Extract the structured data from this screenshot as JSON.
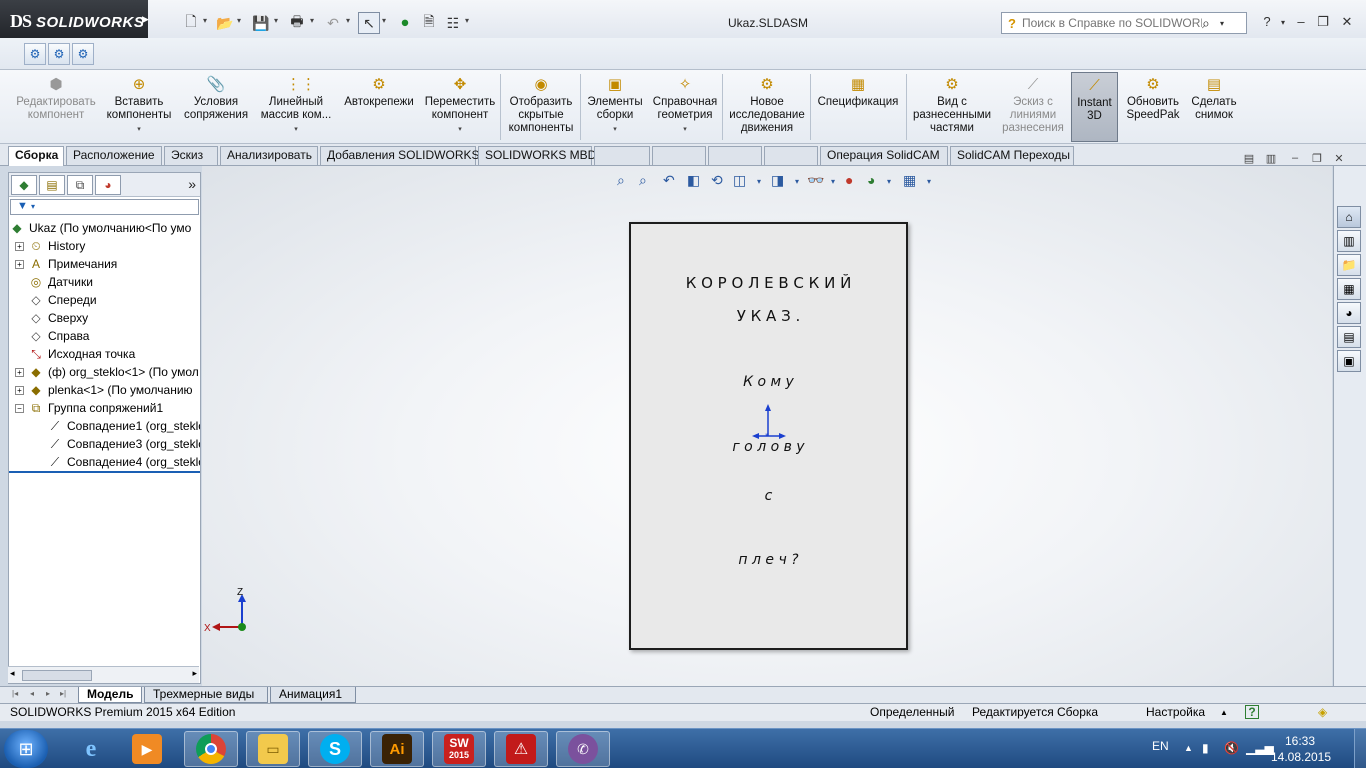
{
  "app": {
    "logo_mark": "DS",
    "logo_text": "SOLIDWORKS",
    "document_title": "Ukaz.SLDASM",
    "help_search_placeholder": "Поиск в Справке по SOLIDWORKS",
    "help_button": "?"
  },
  "command_manager": [
    {
      "label1": "Редактировать",
      "label2": "компонент",
      "label3": "",
      "icon": "edit-component-icon",
      "disabled": true
    },
    {
      "label1": "Вставить",
      "label2": "компоненты",
      "label3": "",
      "icon": "insert-components-icon",
      "disabled": false
    },
    {
      "label1": "Условия",
      "label2": "сопряжения",
      "label3": "",
      "icon": "mate-icon",
      "disabled": false
    },
    {
      "label1": "Линейный",
      "label2": "массив ком...",
      "label3": "",
      "icon": "linear-pattern-icon",
      "disabled": false
    },
    {
      "label1": "Автокрепежи",
      "label2": "",
      "label3": "",
      "icon": "smart-fasteners-icon",
      "disabled": false
    },
    {
      "label1": "Переместить",
      "label2": "компонент",
      "label3": "",
      "icon": "move-component-icon",
      "disabled": false
    },
    {
      "label1": "Отобразить",
      "label2": "скрытые",
      "label3": "компоненты",
      "icon": "show-hidden-icon",
      "disabled": false
    },
    {
      "label1": "Элементы",
      "label2": "сборки",
      "label3": "",
      "icon": "assembly-features-icon",
      "disabled": false
    },
    {
      "label1": "Справочная",
      "label2": "геометрия",
      "label3": "",
      "icon": "reference-geometry-icon",
      "disabled": false
    },
    {
      "label1": "Новое",
      "label2": "исследование",
      "label3": "движения",
      "icon": "motion-study-icon",
      "disabled": false
    },
    {
      "label1": "Спецификация",
      "label2": "",
      "label3": "",
      "icon": "bom-icon",
      "disabled": false
    },
    {
      "label1": "Вид с",
      "label2": "разнесенными",
      "label3": "частями",
      "icon": "exploded-view-icon",
      "disabled": false
    },
    {
      "label1": "Эскиз с",
      "label2": "линиями",
      "label3": "разнесения",
      "icon": "explode-line-sketch-icon",
      "disabled": true
    },
    {
      "label1": "Instant",
      "label2": "3D",
      "label3": "",
      "icon": "instant3d-icon",
      "disabled": false
    },
    {
      "label1": "Обновить",
      "label2": "SpeedPak",
      "label3": "",
      "icon": "speedpak-icon",
      "disabled": false
    },
    {
      "label1": "Сделать",
      "label2": "снимок",
      "label3": "",
      "icon": "snapshot-icon",
      "disabled": false
    }
  ],
  "tabs": [
    "Сборка",
    "Расположение",
    "Эскиз",
    "Анализировать",
    "Добавления SOLIDWORKS",
    "SOLIDWORKS MBD",
    "Операция  SolidCAM",
    "SolidCAM Переходы"
  ],
  "tree": {
    "root": "Ukaz  (По умолчанию<По умо",
    "items": [
      {
        "label": "History",
        "icon": "history-icon",
        "expandable": true
      },
      {
        "label": "Примечания",
        "icon": "annotations-icon",
        "expandable": true
      },
      {
        "label": "Датчики",
        "icon": "sensors-icon",
        "expandable": false
      },
      {
        "label": "Спереди",
        "icon": "plane-icon",
        "expandable": false
      },
      {
        "label": "Сверху",
        "icon": "plane-icon",
        "expandable": false
      },
      {
        "label": "Справа",
        "icon": "plane-icon",
        "expandable": false
      },
      {
        "label": "Исходная точка",
        "icon": "origin-icon",
        "expandable": false
      },
      {
        "label": "(ф) org_steklo<1> (По умол",
        "icon": "part-icon",
        "expandable": true
      },
      {
        "label": "plenka<1> (По умолчанию",
        "icon": "part-icon",
        "expandable": true
      },
      {
        "label": "Группа сопряжений1",
        "icon": "mates-group-icon",
        "expandable": true
      }
    ],
    "mates": [
      "Совпадение1 (org_steklo",
      "Совпадение3 (org_steklo",
      "Совпадение4 (org_steklo"
    ]
  },
  "sheet": {
    "line1": "К О Р О Л Е В С К И Й",
    "line2": "У К А З .",
    "line3": "К о м у",
    "line4": "г о л о в у",
    "line5": "с",
    "line6": "п л е ч ?"
  },
  "triad": {
    "z": "Z",
    "x": "X"
  },
  "bottom_tabs": [
    "Модель",
    "Трехмерные виды",
    "Анимация1"
  ],
  "status": {
    "edition": "SOLIDWORKS Premium 2015 x64 Edition",
    "state": "Определенный",
    "editing": "Редактируется Сборка",
    "custom": "Настройка",
    "help": "?"
  },
  "taskbar": {
    "apps": [
      "internet-explorer",
      "media-player",
      "chrome",
      "explorer",
      "skype",
      "illustrator",
      "solidworks",
      "acrobat",
      "viber"
    ],
    "ai_label": "Ai",
    "sw_label": "SW",
    "sw_year": "2015",
    "lang": "EN",
    "time": "16:33",
    "date": "14.08.2015"
  },
  "colors": {
    "accent": "#1a5fb4",
    "taskbar": "#2a5a94",
    "sheet": "#e9e9e9"
  }
}
